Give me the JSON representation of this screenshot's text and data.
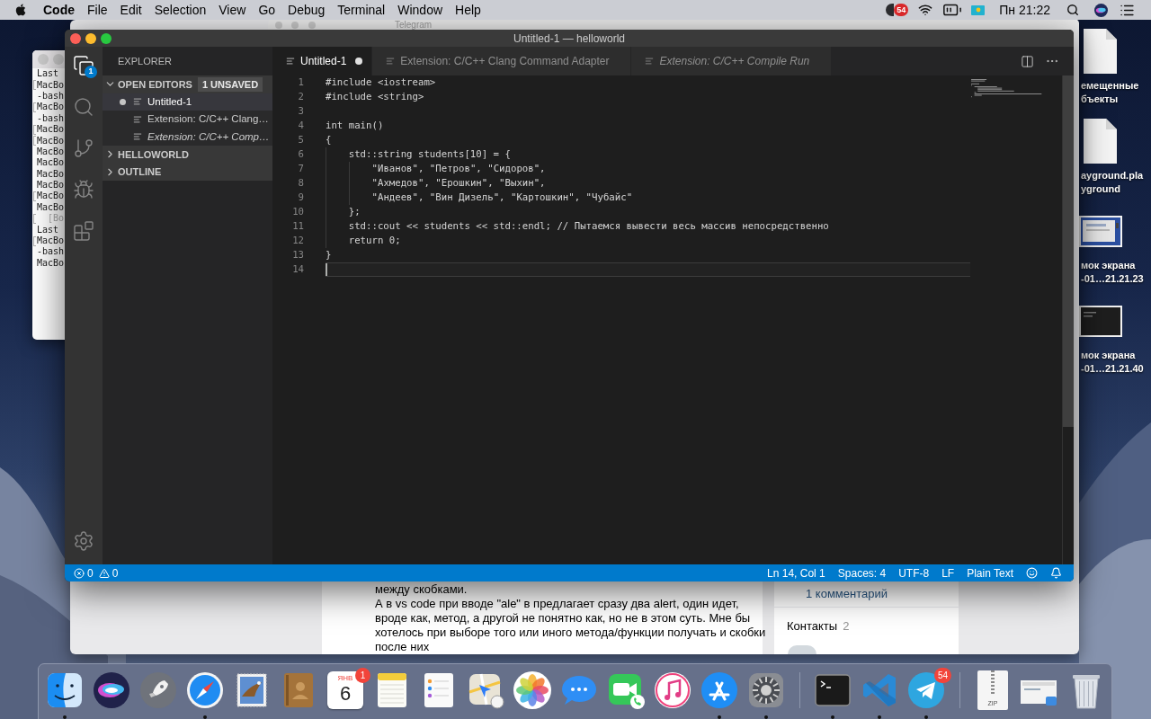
{
  "menu_bar": {
    "app_name": "Code",
    "menus": [
      "File",
      "Edit",
      "Selection",
      "View",
      "Go",
      "Debug",
      "Terminal",
      "Window",
      "Help"
    ],
    "status_badge": "54",
    "clock": "Пн 21:22"
  },
  "background_window": {
    "title": "Telegram"
  },
  "browser_window": {
    "paragraphs": [
      [
        "между скобками."
      ],
      [
        "А в vs code при вводе \"ale\" в предлагает сразу два alert, один идет,",
        "вроде как, метод, а другой не понятно как, но не в этом суть. Мне бы",
        "хотелось при выборе того или иного метода/функции получать и скобки",
        "после них"
      ]
    ],
    "comments_link": "1 комментарий",
    "contacts_title": "Контакты",
    "contacts_count": "2"
  },
  "terminal_window": {
    "lines": [
      {
        "text": "Last",
        "marked": false,
        "dimmed": false
      },
      {
        "text": "MacBo",
        "marked": true,
        "dimmed": false
      },
      {
        "text": "-bash",
        "marked": false,
        "dimmed": false
      },
      {
        "text": "MacBo",
        "marked": true,
        "dimmed": false
      },
      {
        "text": "-bash",
        "marked": false,
        "dimmed": false
      },
      {
        "text": "MacBo",
        "marked": true,
        "dimmed": false
      },
      {
        "text": "MacBo",
        "marked": true,
        "dimmed": false
      },
      {
        "text": "MacBo",
        "marked": false,
        "dimmed": false
      },
      {
        "text": "MacBo",
        "marked": false,
        "dimmed": false
      },
      {
        "text": "MacBo",
        "marked": false,
        "dimmed": false
      },
      {
        "text": "MacBo",
        "marked": false,
        "dimmed": false
      },
      {
        "text": "MacBo",
        "marked": true,
        "dimmed": false
      },
      {
        "text": "MacBo",
        "marked": false,
        "dimmed": false
      },
      {
        "text": "  [Во",
        "marked": true,
        "dimmed": true
      },
      {
        "text": "Last",
        "marked": false,
        "dimmed": false
      },
      {
        "text": "MacBo",
        "marked": true,
        "dimmed": false
      },
      {
        "text": "-bash",
        "marked": false,
        "dimmed": false
      },
      {
        "text": "MacBo",
        "marked": false,
        "dimmed": false
      }
    ]
  },
  "desktop_icons": [
    {
      "kind": "document",
      "label_lines": [
        "емещенные",
        "бъекты"
      ]
    },
    {
      "kind": "document",
      "label_lines": [
        "ayground.pla",
        "yground"
      ]
    },
    {
      "kind": "screenshot-light",
      "label_lines": [
        "мок экрана",
        "-01…21.21.23"
      ]
    },
    {
      "kind": "screenshot-dark",
      "label_lines": [
        "мок экрана",
        "-01…21.21.40"
      ]
    }
  ],
  "vscode": {
    "title": "Untitled-1 — helloworld",
    "activity_bar": [
      {
        "kind": "files",
        "selected": true,
        "badge": "1"
      },
      {
        "kind": "search",
        "selected": false
      },
      {
        "kind": "source-control",
        "selected": false
      },
      {
        "kind": "debug",
        "selected": false
      },
      {
        "kind": "extensions",
        "selected": false
      }
    ],
    "sidebar": {
      "title": "EXPLORER",
      "sections": [
        {
          "title": "OPEN EDITORS",
          "expanded": true,
          "badge": "1 UNSAVED",
          "items": [
            {
              "label": "Untitled-1",
              "selected": true,
              "unsaved": true,
              "preview": false
            },
            {
              "label": "Extension: C/C++ Clang…",
              "selected": false,
              "unsaved": false,
              "preview": false
            },
            {
              "label": "Extension: C/C++ Comp…",
              "selected": false,
              "unsaved": false,
              "preview": true
            }
          ]
        },
        {
          "title": "HELLOWORLD",
          "expanded": false
        },
        {
          "title": "OUTLINE",
          "expanded": false
        }
      ]
    },
    "tabs": [
      {
        "label": "Untitled-1",
        "selected": true,
        "unsaved": true,
        "preview": false
      },
      {
        "label": "Extension: C/C++ Clang Command Adapter",
        "selected": false,
        "unsaved": false,
        "preview": false
      },
      {
        "label": "Extension: C/C++ Compile Run",
        "selected": false,
        "unsaved": false,
        "preview": true
      }
    ],
    "editor": {
      "lines": [
        {
          "number": "1",
          "text": "#include <iostream>",
          "current": false
        },
        {
          "number": "2",
          "text": "#include <string>",
          "current": false
        },
        {
          "number": "3",
          "current": false
        },
        {
          "number": "4",
          "text": "int main()",
          "current": false
        },
        {
          "number": "5",
          "text": "{",
          "current": false
        },
        {
          "number": "6",
          "text": "    std::string students[10] = {",
          "current": false
        },
        {
          "number": "7",
          "text": "        \"Иванов\", \"Петров\", \"Сидоров\",",
          "current": false
        },
        {
          "number": "8",
          "text": "        \"Ахмедов\", \"Ерошкин\", \"Выхин\",",
          "current": false
        },
        {
          "number": "9",
          "text": "        \"Андеев\", \"Вин Дизель\", \"Картошкин\", \"Чубайс\"",
          "current": false
        },
        {
          "number": "10",
          "text": "    };",
          "current": false
        },
        {
          "number": "11",
          "text": "    std::cout << students << std::endl; // Пытаемся вывести весь массив непосредственно",
          "current": false
        },
        {
          "number": "12",
          "text": "    return 0;",
          "current": false
        },
        {
          "number": "13",
          "text": "}",
          "current": false
        },
        {
          "number": "14",
          "current": true
        }
      ]
    },
    "status_bar": {
      "errors": "0",
      "warnings": "0",
      "items": [
        "Ln 14, Col 1",
        "Spaces: 4",
        "UTF-8",
        "LF",
        "Plain Text"
      ]
    }
  },
  "dock": {
    "items": [
      {
        "kind": "finder",
        "running": true
      },
      {
        "kind": "siri",
        "running": false
      },
      {
        "kind": "launchpad",
        "running": false
      },
      {
        "kind": "safari",
        "running": true
      },
      {
        "kind": "mail-stamp",
        "running": false
      },
      {
        "kind": "contacts",
        "running": false
      },
      {
        "kind": "calendar",
        "running": false,
        "month": "ЯНВ",
        "day": "6",
        "badge": "1"
      },
      {
        "kind": "notes",
        "running": false
      },
      {
        "kind": "reminders",
        "running": false
      },
      {
        "kind": "maps",
        "running": false
      },
      {
        "kind": "photos",
        "running": false
      },
      {
        "kind": "messages",
        "running": false
      },
      {
        "kind": "facetime",
        "running": false
      },
      {
        "kind": "itunes",
        "running": false
      },
      {
        "kind": "app-store",
        "running": true
      },
      {
        "kind": "system-preferences",
        "running": true
      },
      {
        "kind": "separator"
      },
      {
        "kind": "terminal",
        "running": true
      },
      {
        "kind": "vscode",
        "running": true
      },
      {
        "kind": "telegram",
        "running": true,
        "badge": "54"
      },
      {
        "kind": "separator"
      },
      {
        "kind": "archive",
        "running": false,
        "label": "ZIP"
      },
      {
        "kind": "screenshot",
        "running": false
      },
      {
        "kind": "trash",
        "running": false
      }
    ]
  }
}
